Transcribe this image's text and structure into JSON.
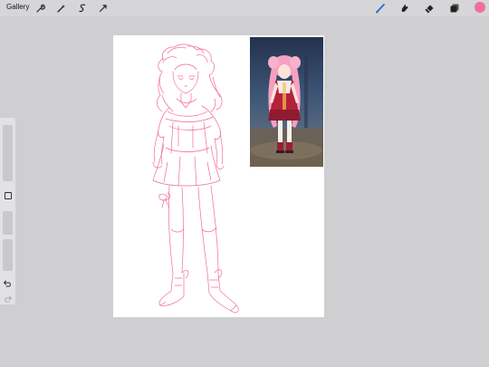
{
  "toolbar": {
    "gallery_label": "Gallery",
    "left_icons": [
      "wrench-icon",
      "magic-wand-icon",
      "selection-icon",
      "transform-arrow-icon"
    ],
    "right_icons": [
      "brush-icon",
      "smudge-icon",
      "eraser-icon",
      "layers-icon"
    ],
    "current_color": "#ef6f9f"
  },
  "sidebar": {
    "icons": [
      "square-modify-icon",
      "undo-icon",
      "redo-icon"
    ]
  },
  "colors": {
    "sketch_line": "#f0648f",
    "background": "#cfcfd1",
    "canvas": "#ffffff"
  }
}
